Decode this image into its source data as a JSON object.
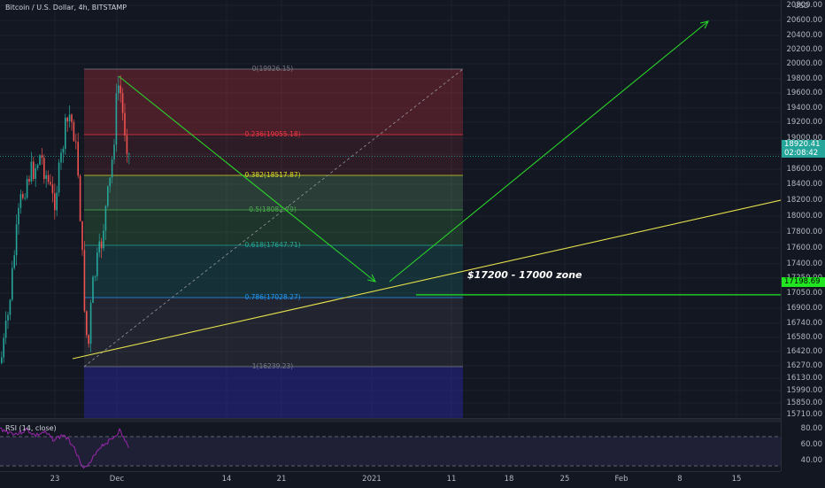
{
  "symbol_title": "Bitcoin / U.S. Dollar, 4h, BITSTAMP",
  "currency": "USD",
  "colors": {
    "background": "#131722",
    "grid": "#1e222d",
    "up": "#26a69a",
    "down": "#ef5350",
    "trend": "#e5e04b",
    "arrow": "#2ad52a",
    "zone": "#21e621",
    "rsi": "#9c27b0"
  },
  "price_axis": {
    "ticks": [
      "20800.00",
      "20600.00",
      "20400.00",
      "20200.00",
      "20000.00",
      "19800.00",
      "19600.00",
      "19400.00",
      "19200.00",
      "19000.00",
      "18800.00",
      "18600.00",
      "18400.00",
      "18200.00",
      "18000.00",
      "17800.00",
      "17600.00",
      "17400.00",
      "17250.00",
      "17050.00",
      "16900.00",
      "16740.00",
      "16580.00",
      "16420.00",
      "16270.00",
      "16130.00",
      "15990.00",
      "15850.00",
      "15710.00"
    ],
    "current_price": "18920.41",
    "countdown": "02:08:42",
    "zone_price": "17198.69"
  },
  "time_axis": {
    "labels": [
      "23",
      "Dec",
      "14",
      "21",
      "2021",
      "11",
      "18",
      "25",
      "Feb",
      "8",
      "15"
    ]
  },
  "rsi": {
    "label": "RSI (14, close)",
    "ticks": [
      "80.00",
      "60.00",
      "40.00"
    ]
  },
  "fib_levels": [
    {
      "label": "0(19926.15)",
      "color": "#787b86"
    },
    {
      "label": "0.236(19055.18)",
      "color": "#f23645"
    },
    {
      "label": "0.382(18517.87)",
      "color": "#d5dd2a"
    },
    {
      "label": "0.5(18082.79)",
      "color": "#4caf50"
    },
    {
      "label": "0.618(17647.71)",
      "color": "#26a69a"
    },
    {
      "label": "0.786(17028.27)",
      "color": "#2196f3"
    },
    {
      "label": "1(16239.23)",
      "color": "#787b86"
    }
  ],
  "annotation": "$17200 - 17000 zone",
  "chart_data": {
    "type": "candlestick",
    "title": "Bitcoin / U.S. Dollar, 4h, BITSTAMP",
    "ylabel": "USD",
    "ylim": [
      15650,
      20900
    ],
    "x_tick_labels": [
      "23",
      "Dec",
      "14",
      "21",
      "2021",
      "11",
      "18",
      "25",
      "Feb",
      "8",
      "15"
    ],
    "last_price": 18920.41,
    "zone_price": 17198.69,
    "fib_retracement": {
      "high": 19926.15,
      "low": 16239.23
    },
    "zone_annotation": "$17200 - 17000 zone"
  }
}
